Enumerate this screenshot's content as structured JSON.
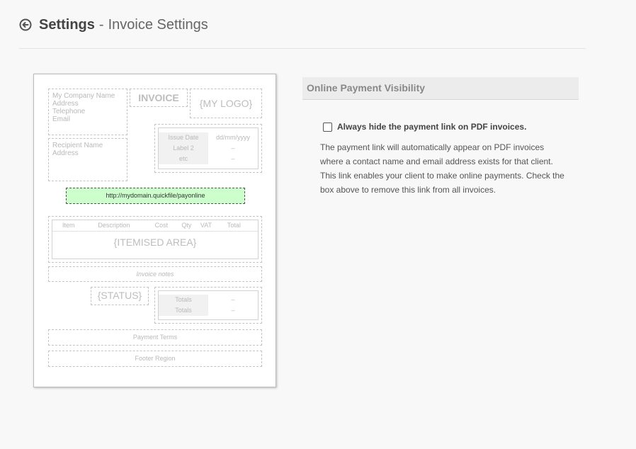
{
  "header": {
    "title": "Settings",
    "separator": "-",
    "subtitle": "Invoice Settings"
  },
  "preview": {
    "company_lines": [
      "My Company Name",
      "Address",
      "Telephone",
      "Email"
    ],
    "invoice_label": "INVOICE",
    "logo_label": "{MY LOGO}",
    "recipient_lines": [
      "Recipient Name",
      "Address"
    ],
    "date_rows": [
      {
        "label": "Issue Date",
        "value": "dd/mm/yyyy"
      },
      {
        "label": "Label 2",
        "value": "–"
      },
      {
        "label": "etc",
        "value": "–"
      }
    ],
    "payment_link": "http://mydomain.quickfile/payonline",
    "item_columns": [
      "Item",
      "Description",
      "Cost",
      "Qty",
      "VAT",
      "Total"
    ],
    "itemised_label": "{ITEMISED AREA}",
    "notes_label": "Invoice notes",
    "status_label": "{STATUS}",
    "total_rows": [
      {
        "label": "Totals",
        "value": "–"
      },
      {
        "label": "Totals",
        "value": "–"
      }
    ],
    "payment_terms": "Payment Terms",
    "footer_region": "Footer Region"
  },
  "panel": {
    "heading": "Online Payment Visibility",
    "checkbox_label": "Always hide the payment link on PDF invoices.",
    "checkbox_checked": false,
    "description": "The payment link will automatically appear on PDF invoices where a contact name and email address exists for that client. This link enables your client to make online payments. Check the box above to remove this link from all invoices."
  },
  "icons": {
    "back": "circle-arrow-left-icon"
  }
}
